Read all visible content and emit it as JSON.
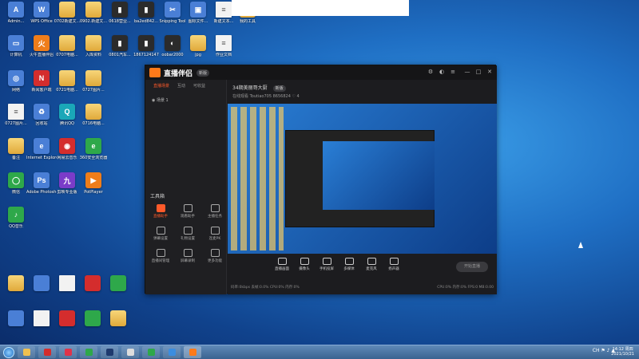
{
  "desktop": {
    "icons": [
      {
        "label": "Admin...",
        "kind": "exe",
        "glyph": "A"
      },
      {
        "label": "WPS Office",
        "kind": "exe",
        "glyph": "W"
      },
      {
        "label": "0702新建文...",
        "kind": "folder",
        "glyph": ""
      },
      {
        "label": "0902.新建文...",
        "kind": "folder",
        "glyph": ""
      },
      {
        "label": "0618营业...",
        "kind": "dark",
        "glyph": "▮"
      },
      {
        "label": "ba2ed842...",
        "kind": "dark",
        "glyph": "▮"
      },
      {
        "label": "Snipping Tool",
        "kind": "exe",
        "glyph": "✂"
      },
      {
        "label": "图标文件...",
        "kind": "exe",
        "glyph": "▣"
      },
      {
        "label": "新建文本...",
        "kind": "doc",
        "glyph": "≡"
      },
      {
        "label": "我的工具",
        "kind": "folder",
        "glyph": ""
      },
      {
        "label": "计算机",
        "kind": "exe",
        "glyph": "▭"
      },
      {
        "label": "火牛直播伴侣",
        "kind": "orange",
        "glyph": "火"
      },
      {
        "label": "0707电脑...",
        "kind": "folder",
        "glyph": ""
      },
      {
        "label": "入库资料",
        "kind": "folder",
        "glyph": ""
      },
      {
        "label": "0801汽车...",
        "kind": "dark",
        "glyph": "▮"
      },
      {
        "label": "1867124147",
        "kind": "dark",
        "glyph": "▮"
      },
      {
        "label": "oobar2000",
        "kind": "dark",
        "glyph": "◐"
      },
      {
        "label": "jpg",
        "kind": "folder",
        "glyph": ""
      },
      {
        "label": "作业文档",
        "kind": "doc",
        "glyph": "≡"
      },
      {
        "label": "网络",
        "kind": "exe",
        "glyph": "◎"
      },
      {
        "label": "新闻客户端",
        "kind": "red",
        "glyph": "N"
      },
      {
        "label": "0721电脑...",
        "kind": "folder",
        "glyph": ""
      },
      {
        "label": "0727图片...",
        "kind": "folder",
        "glyph": ""
      },
      {
        "label": "0727图片...",
        "kind": "doc",
        "glyph": "≡"
      },
      {
        "label": "回收站",
        "kind": "exe",
        "glyph": "♻"
      },
      {
        "label": "腾讯QQ",
        "kind": "teal",
        "glyph": "Q"
      },
      {
        "label": "0716电脑...",
        "kind": "folder",
        "glyph": ""
      },
      {
        "label": "备注",
        "kind": "folder",
        "glyph": ""
      },
      {
        "label": "Internet Explorer",
        "kind": "exe",
        "glyph": "e"
      },
      {
        "label": "网易云音乐",
        "kind": "red",
        "glyph": "◉"
      },
      {
        "label": "360安全浏览器",
        "kind": "green",
        "glyph": "e"
      },
      {
        "label": "微信",
        "kind": "green",
        "glyph": "◯"
      },
      {
        "label": "Adobe Photoshop",
        "kind": "exe",
        "glyph": "Ps"
      },
      {
        "label": "剪映专业版",
        "kind": "purple",
        "glyph": "九"
      },
      {
        "label": "PotPlayer",
        "kind": "orange",
        "glyph": "▶"
      },
      {
        "label": "QQ音乐",
        "kind": "green",
        "glyph": "♪"
      }
    ]
  },
  "app": {
    "name": "直播伴侣",
    "version": "新版",
    "tabs": [
      "直播场景",
      "互动",
      "可收益"
    ],
    "active_tab": "直播场景",
    "scene_label": "场景 1",
    "room_title": "34期美丽哥大厨",
    "room_badge": "新版",
    "room_meta": "在线观看  Toutiao705  8656824  ♡ 4",
    "tools_title": "工具箱",
    "tools": [
      {
        "label": "直播助手",
        "hot": true
      },
      {
        "label": "观看助手",
        "hot": false
      },
      {
        "label": "主播任务",
        "hot": false
      },
      {
        "label": "弹幕设置",
        "hot": false
      },
      {
        "label": "礼物设置",
        "hot": false
      },
      {
        "label": "连麦PK",
        "hot": false
      },
      {
        "label": "直播间管理",
        "hot": false
      },
      {
        "label": "屏幕录制",
        "hot": false
      },
      {
        "label": "更多功能",
        "hot": false
      }
    ],
    "bottom_controls": [
      {
        "label": "直播画面"
      },
      {
        "label": "摄像头"
      },
      {
        "label": "手机投屏"
      },
      {
        "label": "多媒体"
      },
      {
        "label": "麦克风"
      },
      {
        "label": "扬声器"
      }
    ],
    "start_button": "开始直播",
    "status_left": "码率:0kbps  丢帧:0.0%  CPU:0%  内存:0%",
    "status_right": "CPU:0%  内存:0%  FPS:0  MB:0.00"
  },
  "taskbar": {
    "clock_time": "14:12 周四",
    "clock_date": "2021/10/21",
    "tray": "CH ⚑ ♪ ▲"
  }
}
